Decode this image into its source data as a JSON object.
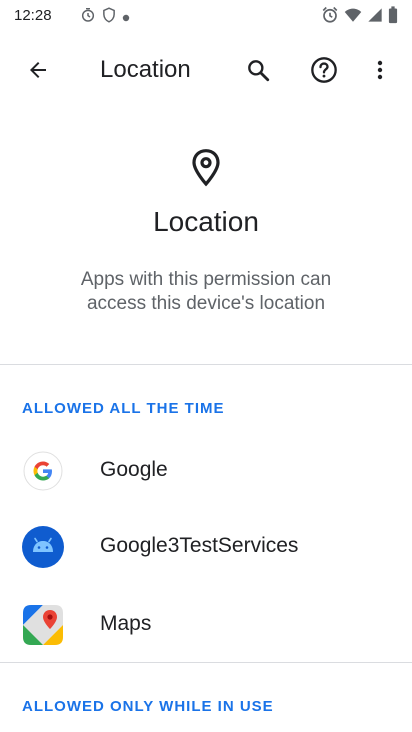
{
  "status_bar": {
    "time": "12:28"
  },
  "app_bar": {
    "title": "Location",
    "back_icon": "arrow-back-icon",
    "search_icon": "search-icon",
    "help_icon": "help-icon",
    "more_icon": "more-vert-icon"
  },
  "header": {
    "title": "Location",
    "description": "Apps with this permission can access this device's location"
  },
  "sections": {
    "allowed_all_time": {
      "title": "ALLOWED ALL THE TIME",
      "apps": [
        {
          "label": "Google",
          "icon": "google-icon"
        },
        {
          "label": "Google3TestServices",
          "icon": "android-icon"
        },
        {
          "label": "Maps",
          "icon": "maps-icon"
        }
      ]
    },
    "allowed_while_in_use": {
      "title": "ALLOWED ONLY WHILE IN USE"
    }
  },
  "colors": {
    "accent": "#1a73e8",
    "android_blue": "#0f5ccf"
  }
}
